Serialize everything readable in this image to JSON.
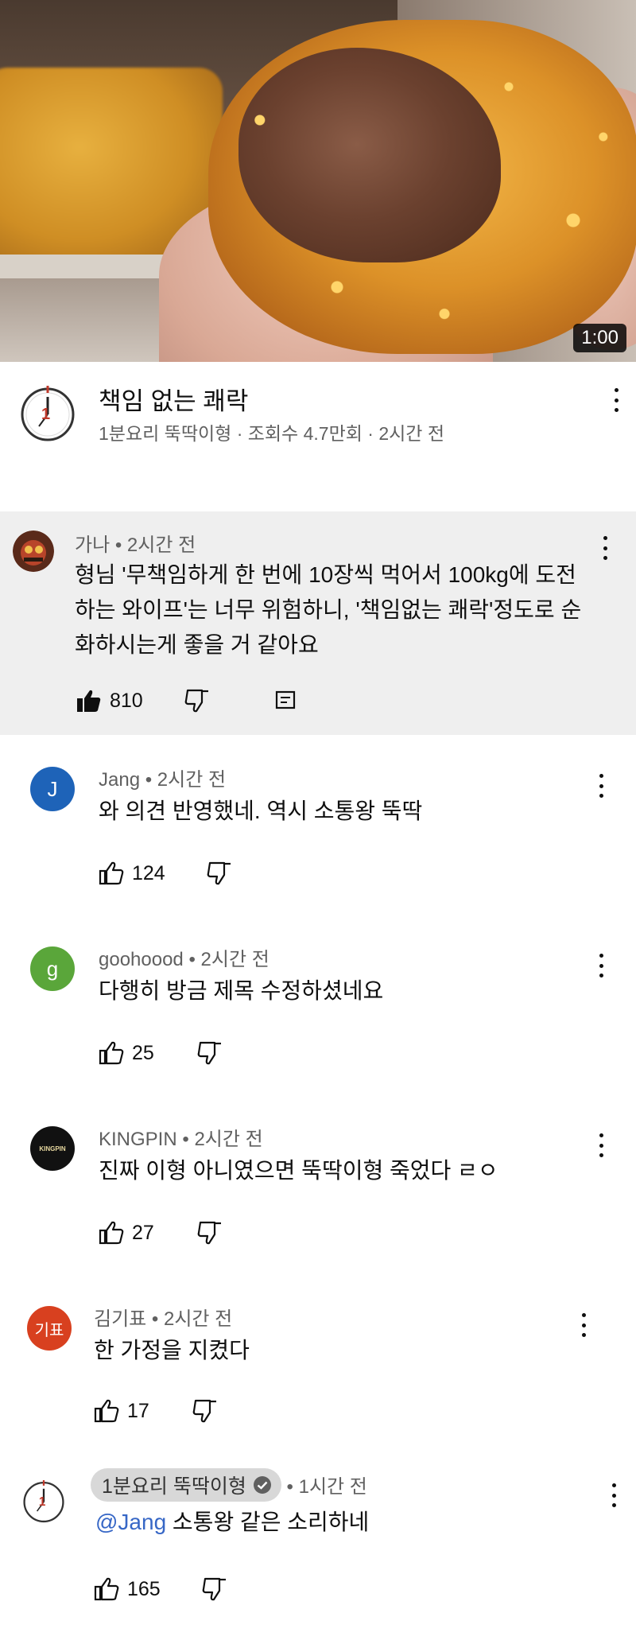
{
  "video": {
    "duration": "1:00",
    "title": "책임 없는 쾌락",
    "meta": "1분요리 뚝딱이형 · 조회수 4.7만회 · 2시간 전"
  },
  "comments": [
    {
      "author": "가나",
      "time": "2시간 전",
      "text": "형님 '무책임하게 한 번에 10장씩 먹어서 100kg에 도전하는 와이프'는 너무 위험하니, '책임없는 쾌락'정도로 순화하시는게 좋을 거 같아요",
      "likes": "810",
      "highlighted": true
    },
    {
      "author": "Jang",
      "avatar_letter": "J",
      "avatar_color": "#1e63b8",
      "time": "2시간 전",
      "text": "와 의견 반영했네. 역시 소통왕 뚝딱",
      "likes": "124"
    },
    {
      "author": "goohoood",
      "avatar_letter": "g",
      "avatar_color": "#5aa63a",
      "time": "2시간 전",
      "text": "다행히 방금 제목 수정하셨네요",
      "likes": "25"
    },
    {
      "author": "KINGPIN",
      "avatar_label": "KINGPIN",
      "avatar_color": "#111111",
      "time": "2시간 전",
      "text": "진짜 이형 아니였으면 뚝딱이형 죽었다 ㄹㅇ",
      "likes": "27"
    },
    {
      "author": "김기표",
      "avatar_letter": "기표",
      "avatar_color": "#d8401f",
      "time": "2시간 전",
      "text": "한 가정을 지켰다",
      "likes": "17"
    },
    {
      "author": "1분요리 뚝딱이형",
      "time": "1시간 전",
      "mention": "@Jang",
      "text": "소통왕 같은 소리하네",
      "likes": "165",
      "is_owner": true
    }
  ]
}
